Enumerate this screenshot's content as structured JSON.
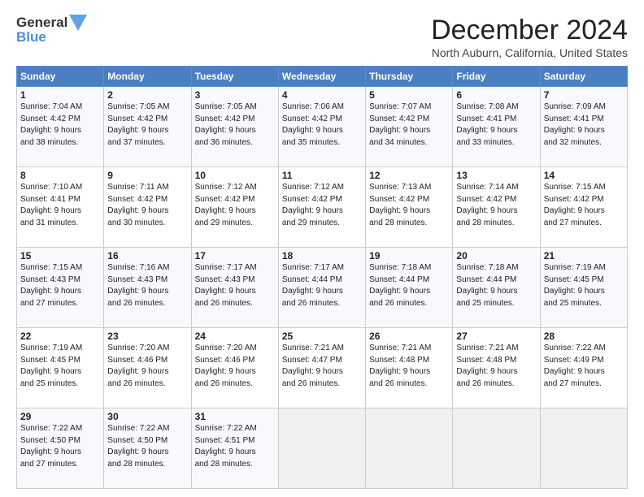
{
  "logo": {
    "line1": "General",
    "line2": "Blue",
    "icon_color": "#4a90d9"
  },
  "title": "December 2024",
  "subtitle": "North Auburn, California, United States",
  "days_of_week": [
    "Sunday",
    "Monday",
    "Tuesday",
    "Wednesday",
    "Thursday",
    "Friday",
    "Saturday"
  ],
  "weeks": [
    [
      {
        "day": "1",
        "sunrise": "7:04 AM",
        "sunset": "4:42 PM",
        "daylight_hours": "9",
        "daylight_minutes": "38"
      },
      {
        "day": "2",
        "sunrise": "7:05 AM",
        "sunset": "4:42 PM",
        "daylight_hours": "9",
        "daylight_minutes": "37"
      },
      {
        "day": "3",
        "sunrise": "7:05 AM",
        "sunset": "4:42 PM",
        "daylight_hours": "9",
        "daylight_minutes": "36"
      },
      {
        "day": "4",
        "sunrise": "7:06 AM",
        "sunset": "4:42 PM",
        "daylight_hours": "9",
        "daylight_minutes": "35"
      },
      {
        "day": "5",
        "sunrise": "7:07 AM",
        "sunset": "4:42 PM",
        "daylight_hours": "9",
        "daylight_minutes": "34"
      },
      {
        "day": "6",
        "sunrise": "7:08 AM",
        "sunset": "4:41 PM",
        "daylight_hours": "9",
        "daylight_minutes": "33"
      },
      {
        "day": "7",
        "sunrise": "7:09 AM",
        "sunset": "4:41 PM",
        "daylight_hours": "9",
        "daylight_minutes": "32"
      }
    ],
    [
      {
        "day": "8",
        "sunrise": "7:10 AM",
        "sunset": "4:41 PM",
        "daylight_hours": "9",
        "daylight_minutes": "31"
      },
      {
        "day": "9",
        "sunrise": "7:11 AM",
        "sunset": "4:42 PM",
        "daylight_hours": "9",
        "daylight_minutes": "30"
      },
      {
        "day": "10",
        "sunrise": "7:12 AM",
        "sunset": "4:42 PM",
        "daylight_hours": "9",
        "daylight_minutes": "29"
      },
      {
        "day": "11",
        "sunrise": "7:12 AM",
        "sunset": "4:42 PM",
        "daylight_hours": "9",
        "daylight_minutes": "29"
      },
      {
        "day": "12",
        "sunrise": "7:13 AM",
        "sunset": "4:42 PM",
        "daylight_hours": "9",
        "daylight_minutes": "28"
      },
      {
        "day": "13",
        "sunrise": "7:14 AM",
        "sunset": "4:42 PM",
        "daylight_hours": "9",
        "daylight_minutes": "28"
      },
      {
        "day": "14",
        "sunrise": "7:15 AM",
        "sunset": "4:42 PM",
        "daylight_hours": "9",
        "daylight_minutes": "27"
      }
    ],
    [
      {
        "day": "15",
        "sunrise": "7:15 AM",
        "sunset": "4:43 PM",
        "daylight_hours": "9",
        "daylight_minutes": "27"
      },
      {
        "day": "16",
        "sunrise": "7:16 AM",
        "sunset": "4:43 PM",
        "daylight_hours": "9",
        "daylight_minutes": "26"
      },
      {
        "day": "17",
        "sunrise": "7:17 AM",
        "sunset": "4:43 PM",
        "daylight_hours": "9",
        "daylight_minutes": "26"
      },
      {
        "day": "18",
        "sunrise": "7:17 AM",
        "sunset": "4:44 PM",
        "daylight_hours": "9",
        "daylight_minutes": "26"
      },
      {
        "day": "19",
        "sunrise": "7:18 AM",
        "sunset": "4:44 PM",
        "daylight_hours": "9",
        "daylight_minutes": "26"
      },
      {
        "day": "20",
        "sunrise": "7:18 AM",
        "sunset": "4:44 PM",
        "daylight_hours": "9",
        "daylight_minutes": "25"
      },
      {
        "day": "21",
        "sunrise": "7:19 AM",
        "sunset": "4:45 PM",
        "daylight_hours": "9",
        "daylight_minutes": "25"
      }
    ],
    [
      {
        "day": "22",
        "sunrise": "7:19 AM",
        "sunset": "4:45 PM",
        "daylight_hours": "9",
        "daylight_minutes": "25"
      },
      {
        "day": "23",
        "sunrise": "7:20 AM",
        "sunset": "4:46 PM",
        "daylight_hours": "9",
        "daylight_minutes": "26"
      },
      {
        "day": "24",
        "sunrise": "7:20 AM",
        "sunset": "4:46 PM",
        "daylight_hours": "9",
        "daylight_minutes": "26"
      },
      {
        "day": "25",
        "sunrise": "7:21 AM",
        "sunset": "4:47 PM",
        "daylight_hours": "9",
        "daylight_minutes": "26"
      },
      {
        "day": "26",
        "sunrise": "7:21 AM",
        "sunset": "4:48 PM",
        "daylight_hours": "9",
        "daylight_minutes": "26"
      },
      {
        "day": "27",
        "sunrise": "7:21 AM",
        "sunset": "4:48 PM",
        "daylight_hours": "9",
        "daylight_minutes": "26"
      },
      {
        "day": "28",
        "sunrise": "7:22 AM",
        "sunset": "4:49 PM",
        "daylight_hours": "9",
        "daylight_minutes": "27"
      }
    ],
    [
      {
        "day": "29",
        "sunrise": "7:22 AM",
        "sunset": "4:50 PM",
        "daylight_hours": "9",
        "daylight_minutes": "27"
      },
      {
        "day": "30",
        "sunrise": "7:22 AM",
        "sunset": "4:50 PM",
        "daylight_hours": "9",
        "daylight_minutes": "28"
      },
      {
        "day": "31",
        "sunrise": "7:22 AM",
        "sunset": "4:51 PM",
        "daylight_hours": "9",
        "daylight_minutes": "28"
      },
      null,
      null,
      null,
      null
    ]
  ],
  "labels": {
    "sunrise": "Sunrise:",
    "sunset": "Sunset:",
    "daylight": "Daylight: {h} hours and {m} minutes."
  }
}
